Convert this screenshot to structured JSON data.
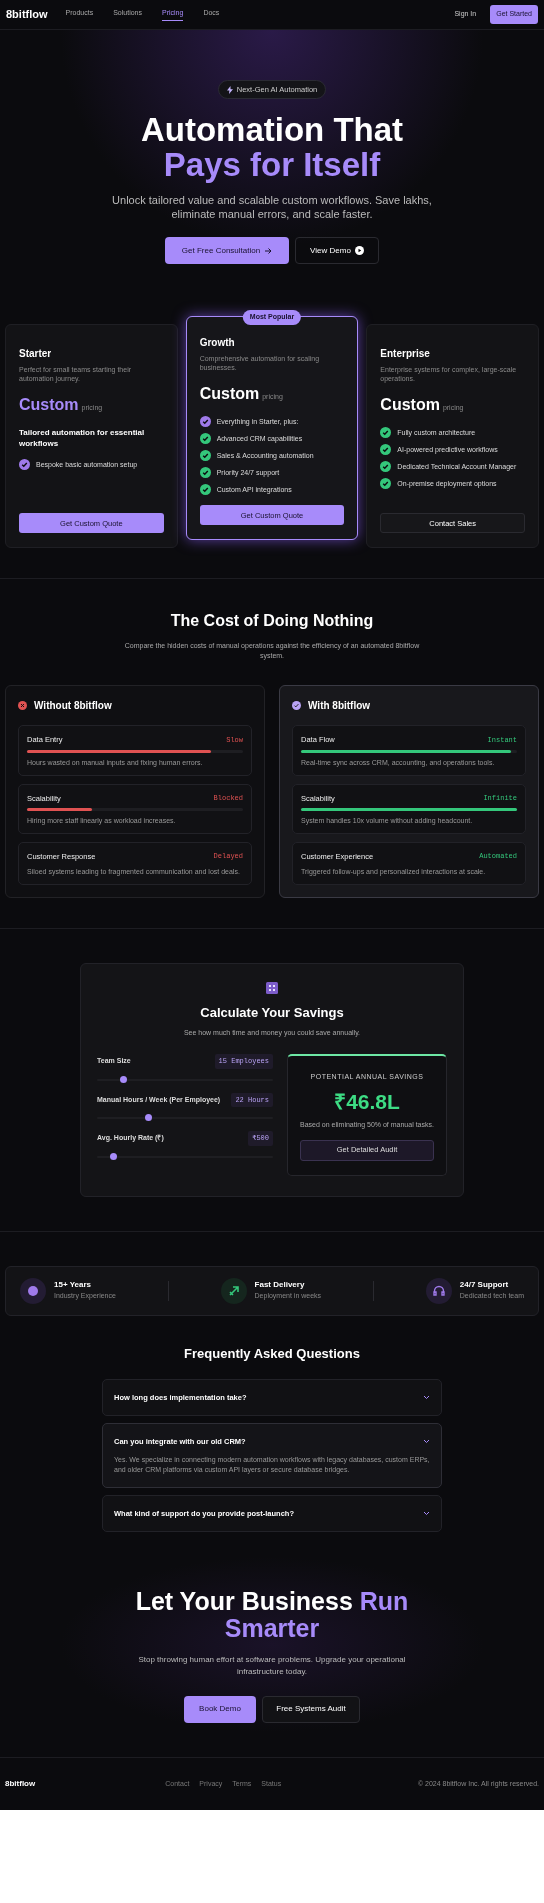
{
  "nav": {
    "logo": "8bitflow",
    "links": [
      {
        "label": "Products",
        "selected": false
      },
      {
        "label": "Solutions",
        "selected": false
      },
      {
        "label": "Pricing",
        "selected": true
      },
      {
        "label": "Docs",
        "selected": false
      }
    ],
    "sign_in": "Sign In",
    "cta": "Get Started"
  },
  "hero": {
    "badge": "Next-Gen AI Automation",
    "title": "Automation That",
    "title_accent": "Pays for Itself",
    "subtitle": "Unlock tailored value and scalable custom workflows. Save lakhs, eliminate manual errors, and scale faster.",
    "primary": "Get Free Consultation",
    "secondary": "View Demo"
  },
  "plans": [
    {
      "name": "Starter",
      "featured": false,
      "description": "Perfect for small teams starting their automation journey.",
      "price": "Custom",
      "price_note": "pricing",
      "accent": true,
      "tagline": "Tailored automation for essential workflows",
      "features": [
        {
          "text": "Bespoke basic automation setup",
          "color": "#9f7aea"
        }
      ],
      "button": "Get Custom Quote",
      "primary_button": true
    },
    {
      "name": "Growth",
      "featured": true,
      "badge": "Most Popular",
      "description": "Comprehensive automation for scaling businesses.",
      "price": "Custom",
      "price_note": "pricing",
      "accent": false,
      "features": [
        {
          "text": "Everything in Starter, plus:",
          "color": "#9f7aea"
        },
        {
          "text": "Advanced CRM capabilities",
          "color": "#34c77b"
        },
        {
          "text": "Sales & Accounting automation",
          "color": "#34c77b"
        },
        {
          "text": "Priority 24/7 support",
          "color": "#34c77b"
        },
        {
          "text": "Custom API integrations",
          "color": "#34c77b"
        }
      ],
      "button": "Get Custom Quote",
      "primary_button": true
    },
    {
      "name": "Enterprise",
      "featured": false,
      "description": "Enterprise systems for complex, large-scale operations.",
      "price": "Custom",
      "price_note": "pricing",
      "accent": false,
      "features": [
        {
          "text": "Fully custom architecture",
          "color": "#34c77b"
        },
        {
          "text": "AI-powered predictive workflows",
          "color": "#34c77b"
        },
        {
          "text": "Dedicated Technical Account Manager",
          "color": "#34c77b"
        },
        {
          "text": "On-premise deployment options",
          "color": "#34c77b"
        }
      ],
      "button": "Contact Sales",
      "primary_button": false
    }
  ],
  "cost": {
    "title": "The Cost of Doing Nothing",
    "subtitle": "Compare the hidden costs of manual operations against the efficiency of an automated 8bitflow system.",
    "panels": [
      {
        "kind": "bad",
        "title": "Without 8bitflow",
        "rows": [
          {
            "title": "Data Entry",
            "status": "Slow",
            "level": 0.85,
            "description": "Hours wasted on manual inputs and fixing human errors."
          },
          {
            "title": "Scalability",
            "status": "Blocked",
            "level": 0.3,
            "description": "Hiring more staff linearly as workload increases."
          },
          {
            "title": "Customer Response",
            "status": "Delayed",
            "description": "Siloed systems leading to fragmented communication and lost deals."
          }
        ]
      },
      {
        "kind": "good",
        "title": "With 8bitflow",
        "rows": [
          {
            "title": "Data Flow",
            "status": "Instant",
            "level": 0.97,
            "description": "Real-time sync across CRM, accounting, and operations tools."
          },
          {
            "title": "Scalability",
            "status": "Infinite",
            "level": 1,
            "description": "System handles 10x volume without adding headcount."
          },
          {
            "title": "Customer Experience",
            "status": "Automated",
            "description": "Triggered follow-ups and personalized interactions at scale."
          }
        ]
      }
    ]
  },
  "calculator": {
    "title": "Calculate Your Savings",
    "subtitle": "See how much time and money you could save annually.",
    "sliders": [
      {
        "label": "Team Size",
        "value": "15 Employees",
        "level": 0.15
      },
      {
        "label": "Manual Hours / Week (Per Employee)",
        "value": "22 Hours",
        "level": 0.29
      },
      {
        "label": "Avg. Hourly Rate (₹)",
        "value": "₹500",
        "level": 0.09
      }
    ],
    "result": {
      "label": "POTENTIAL ANNUAL SAVINGS",
      "amount": "₹46.8L",
      "note": "Based on eliminating 50% of manual tasks.",
      "button": "Get Detailed Audit"
    }
  },
  "stats": [
    {
      "kind": "award",
      "title": "15+ Years",
      "subtitle": "Industry Experience"
    },
    {
      "kind": "rocket",
      "title": "Fast Delivery",
      "subtitle": "Deployment in weeks"
    },
    {
      "kind": "support",
      "title": "24/7 Support",
      "subtitle": "Dedicated tech team"
    }
  ],
  "faq": {
    "title": "Frequently Asked Questions",
    "items": [
      {
        "question": "How long does implementation take?",
        "expanded": false
      },
      {
        "question": "Can you integrate with our old CRM?",
        "expanded": true,
        "answer": "Yes. We specialize in connecting modern automation workflows with legacy databases, custom ERPs, and older CRM platforms via custom API layers or secure database bridges."
      },
      {
        "question": "What kind of support do you provide post-launch?",
        "expanded": false
      }
    ]
  },
  "cta": {
    "title": "Let Your Business",
    "title_accent": "Run Smarter",
    "subtitle": "Stop throwing human effort at software problems. Upgrade your operational infrastructure today.",
    "primary": "Book Demo",
    "secondary": "Free Systems Audit"
  },
  "footer": {
    "logo": "8bitflow",
    "links": [
      "Contact",
      "Privacy",
      "Terms",
      "Status"
    ],
    "copyright": "© 2024 8bitflow Inc. All rights reserved."
  }
}
